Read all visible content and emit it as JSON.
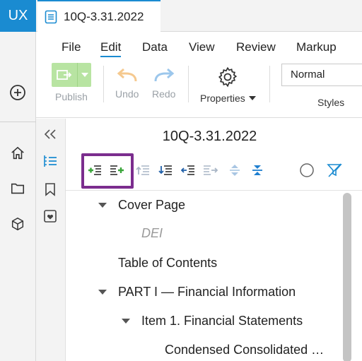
{
  "app": {
    "logo": "UX"
  },
  "tab": {
    "title": "10Q-3.31.2022"
  },
  "menu": [
    "File",
    "Edit",
    "Data",
    "View",
    "Review",
    "Markup"
  ],
  "ribbon": {
    "publish": "Publish",
    "undo": "Undo",
    "redo": "Redo",
    "properties": "Properties",
    "style_value": "Normal",
    "styles": "Styles"
  },
  "outline": {
    "title": "10Q-3.31.2022",
    "items": [
      {
        "label": "Cover Page",
        "expanded": true
      },
      {
        "label": "DEI"
      },
      {
        "label": "Table of Contents"
      },
      {
        "label": "PART I — Financial Information",
        "expanded": true
      },
      {
        "label": "Item 1. Financial Statements",
        "expanded": true
      },
      {
        "label": "Condensed Consolidated …"
      }
    ]
  },
  "colors": {
    "accent": "#1a8bd1",
    "publish": "#b8e4a2",
    "highlight": "#7b2d8e",
    "add_green": "#3aa53a",
    "indent_blue": "#1f5fa8"
  },
  "icons": [
    "plus-circle-icon",
    "home-icon",
    "folder-icon",
    "cube-icon",
    "gear-icon",
    "undo-icon",
    "redo-icon",
    "double-chevron-left-icon",
    "outline-list-icon",
    "bookmark-icon",
    "favorite-icon",
    "circle-icon",
    "filter-off-icon"
  ]
}
